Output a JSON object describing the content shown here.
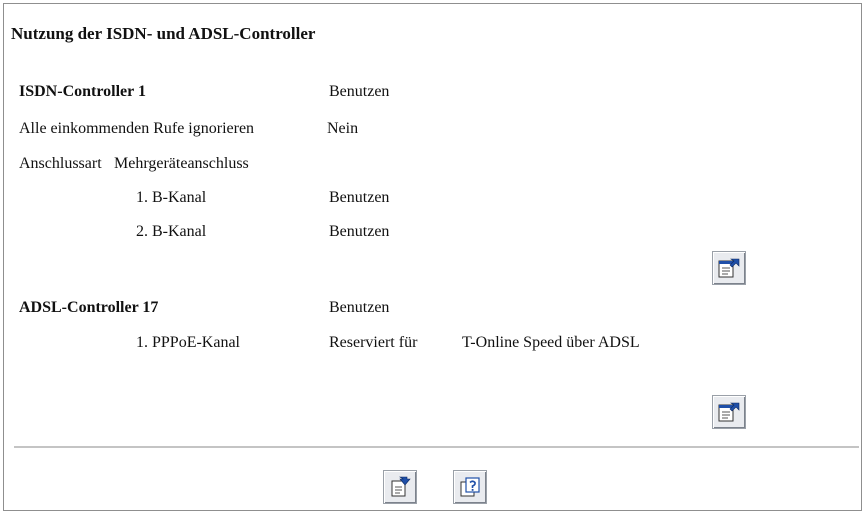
{
  "page": {
    "title": "Nutzung der ISDN- und ADSL-Controller"
  },
  "isdn": {
    "name": "ISDN-Controller 1",
    "status": "Benutzen",
    "ignore_label": "Alle einkommenden Rufe ignorieren",
    "ignore_value": "Nein",
    "type_label": "Anschlussart",
    "type_value": "Mehrgeräteanschluss",
    "channels": [
      {
        "label": "1. B-Kanal",
        "value": "Benutzen"
      },
      {
        "label": "2. B-Kanal",
        "value": "Benutzen"
      }
    ],
    "edit_icon": "edit-properties-icon"
  },
  "adsl": {
    "name": "ADSL-Controller 17",
    "status": "Benutzen",
    "channels": [
      {
        "label": "1. PPPoE-Kanal",
        "value": "Reserviert für",
        "detail": "T-Online Speed über ADSL"
      }
    ],
    "edit_icon": "edit-properties-icon"
  },
  "footer": {
    "buttons": [
      {
        "icon": "save-apply-icon"
      },
      {
        "icon": "help-icon"
      }
    ]
  },
  "colors": {
    "icon_blue": "#1f4fa8",
    "separator": "#c4c4c4",
    "frame": "#8f8f8f"
  }
}
